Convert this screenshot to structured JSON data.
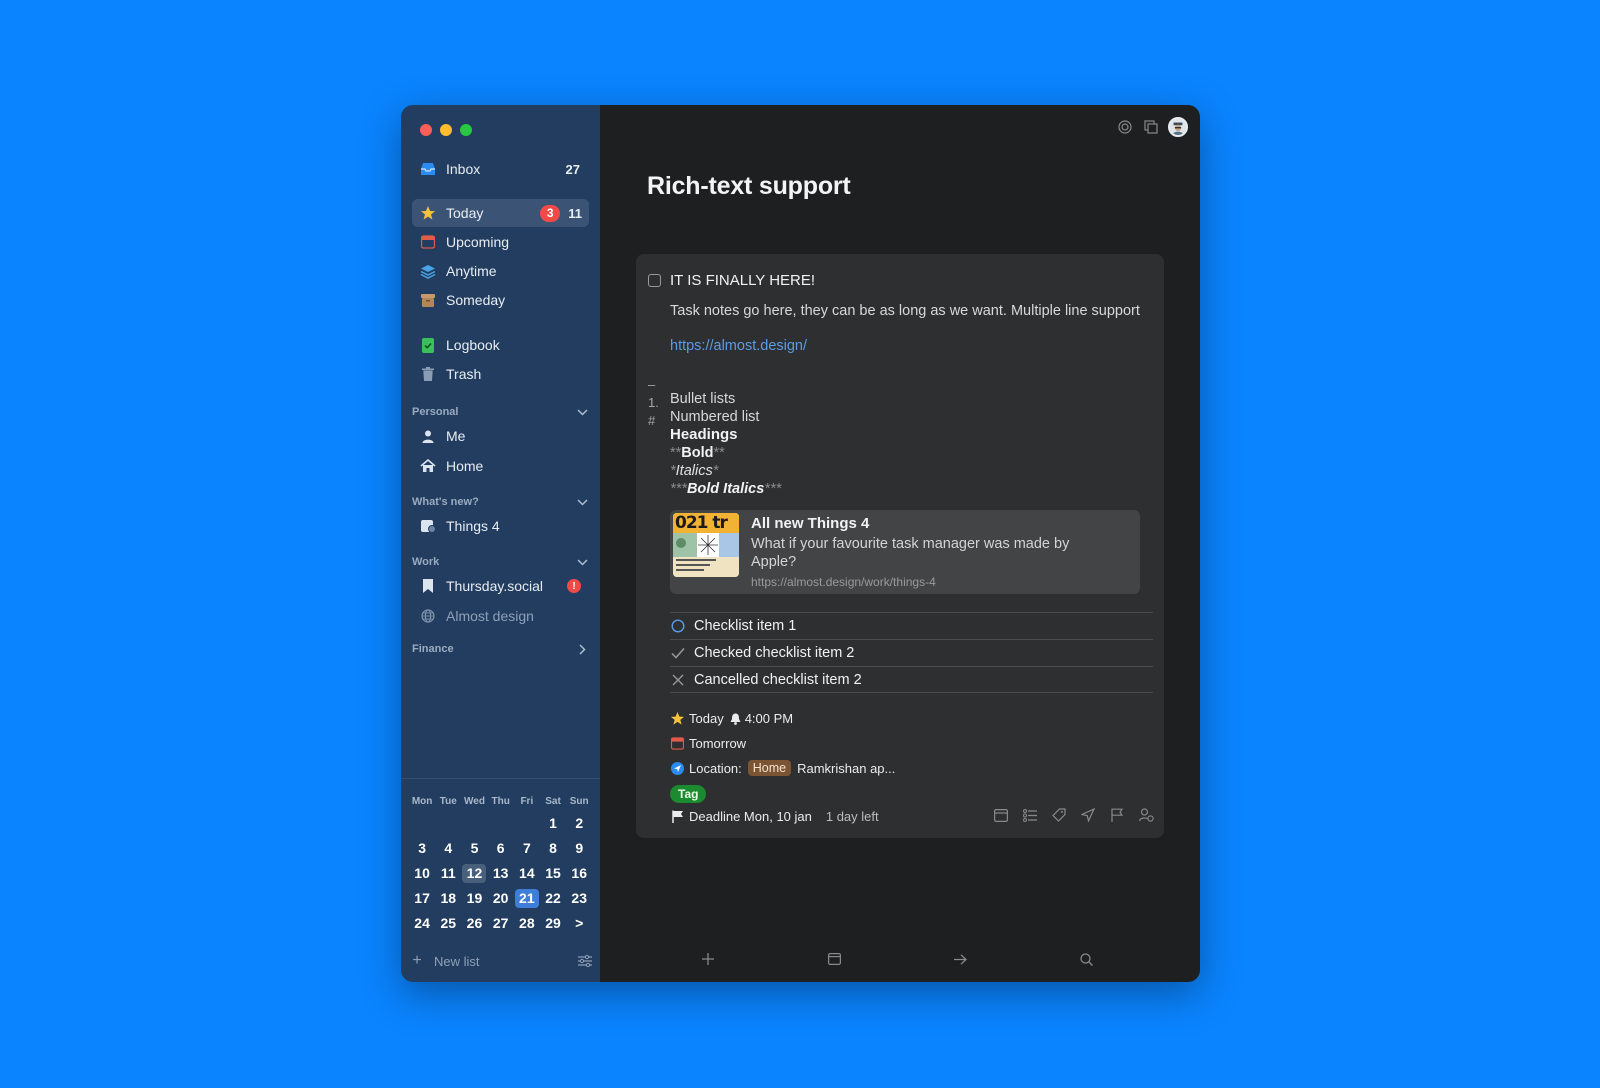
{
  "sidebar": {
    "inbox": {
      "label": "Inbox",
      "count": "27"
    },
    "items": [
      {
        "label": "Today",
        "badge": "3",
        "count": "11",
        "icon": "star-icon"
      },
      {
        "label": "Upcoming",
        "icon": "calendar-icon"
      },
      {
        "label": "Anytime",
        "icon": "layers-icon"
      },
      {
        "label": "Someday",
        "icon": "archive-box-icon"
      },
      {
        "label": "Logbook",
        "icon": "logbook-icon"
      },
      {
        "label": "Trash",
        "icon": "trash-icon"
      }
    ],
    "sections": [
      {
        "title": "Personal",
        "items": [
          {
            "label": "Me",
            "icon": "person-icon"
          },
          {
            "label": "Home",
            "icon": "house-icon"
          }
        ]
      },
      {
        "title": "What's new?",
        "items": [
          {
            "label": "Things 4",
            "icon": "project-icon"
          }
        ]
      },
      {
        "title": "Work",
        "items": [
          {
            "label": "Thursday.social",
            "icon": "bookmark-icon"
          },
          {
            "label": "Almost design",
            "icon": "globe-icon"
          }
        ]
      },
      {
        "title": "Finance",
        "items": []
      }
    ],
    "calendar": {
      "dow": [
        "Mon",
        "Tue",
        "Wed",
        "Thu",
        "Fri",
        "Sat",
        "Sun"
      ],
      "days": [
        "",
        "",
        "",
        "",
        "",
        "1",
        "2",
        "3",
        "4",
        "5",
        "6",
        "7",
        "8",
        "9",
        "10",
        "11",
        "12",
        "13",
        "14",
        "15",
        "16",
        "17",
        "18",
        "19",
        "20",
        "21",
        "22",
        "23",
        "24",
        "25",
        "26",
        "27",
        "28",
        "29",
        ">"
      ],
      "today": "12",
      "selected": "21"
    },
    "new_list": "New list"
  },
  "main": {
    "title": "Rich-text support",
    "task": {
      "title": "IT IS FINALLY HERE!",
      "notes": "Task notes go here, they can be as long as we want. Multiple line support",
      "link": "https://almost.design/",
      "md_marks": [
        "–",
        "1.",
        "#"
      ],
      "bullet": "Bullet lists",
      "numbered": "Numbered list",
      "heading": "Headings",
      "bold_mark": "**",
      "bold": "Bold",
      "italic_mark": "*",
      "italic": "Italics",
      "bolditalic_mark": "***",
      "bolditalic": "Bold Italics",
      "link_card": {
        "title": "All new Things 4",
        "description": "What if your favourite task manager was made by Apple?",
        "url": "https://almost.design/work/things-4",
        "thumb_text": "021 tr"
      },
      "checklist": [
        {
          "label": "Checklist item 1",
          "state": "open"
        },
        {
          "label": "Checked checklist item 2",
          "state": "checked"
        },
        {
          "label": "Cancelled checklist item 2",
          "state": "cancelled"
        }
      ],
      "when": "Today",
      "reminder": "4:00 PM",
      "tomorrow": "Tomorrow",
      "location_label": "Location:",
      "location_chip": "Home",
      "location_text": "Ramkrishan ap...",
      "tag": "Tag",
      "deadline": "Deadline Mon, 10 jan",
      "deadline_left": "1 day left"
    }
  },
  "colors": {
    "background": "#0a84ff",
    "sidebar": "#223d5f",
    "main": "#1e1f21",
    "card": "#2e2f31",
    "link": "#5b9be8",
    "badge": "#ef4a47",
    "tag": "#1c8a2e"
  }
}
